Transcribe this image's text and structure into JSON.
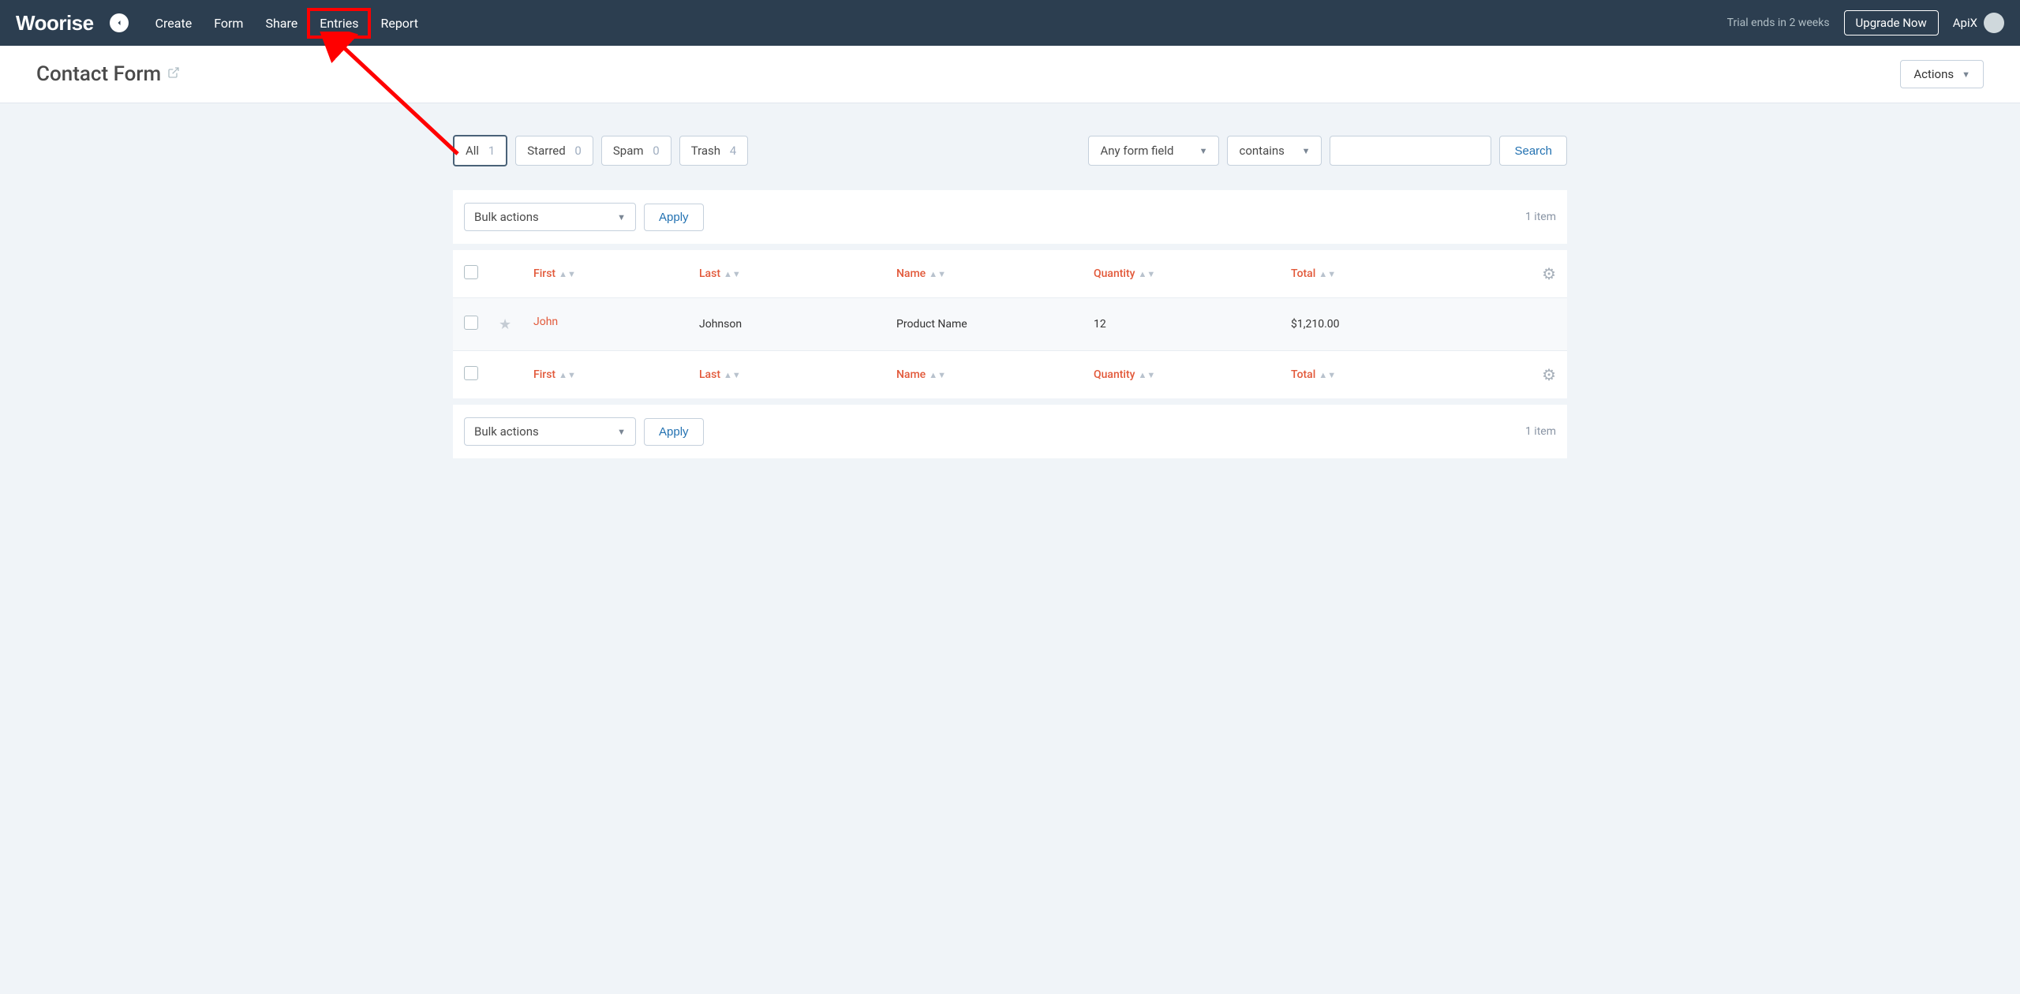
{
  "brand": "Woorise",
  "nav": {
    "items": [
      "Create",
      "Form",
      "Share",
      "Entries",
      "Report"
    ],
    "highlighted_index": 3
  },
  "topright": {
    "trial_text": "Trial ends in 2 weeks",
    "upgrade_label": "Upgrade Now",
    "username": "ApiX"
  },
  "page": {
    "title": "Contact Form",
    "actions_label": "Actions"
  },
  "filters": {
    "tabs": [
      {
        "label": "All",
        "count": "1",
        "active": true
      },
      {
        "label": "Starred",
        "count": "0",
        "active": false
      },
      {
        "label": "Spam",
        "count": "0",
        "active": false
      },
      {
        "label": "Trash",
        "count": "4",
        "active": false
      }
    ],
    "field_select": "Any form field",
    "operator_select": "contains",
    "search_value": "",
    "search_label": "Search"
  },
  "toolbar": {
    "bulk_label": "Bulk actions",
    "apply_label": "Apply",
    "item_count": "1 item"
  },
  "table": {
    "columns": [
      "First",
      "Last",
      "Name",
      "Quantity",
      "Total"
    ],
    "rows": [
      {
        "first": "John",
        "last": "Johnson",
        "name": "Product Name",
        "quantity": "12",
        "total": "$1,210.00"
      }
    ]
  }
}
